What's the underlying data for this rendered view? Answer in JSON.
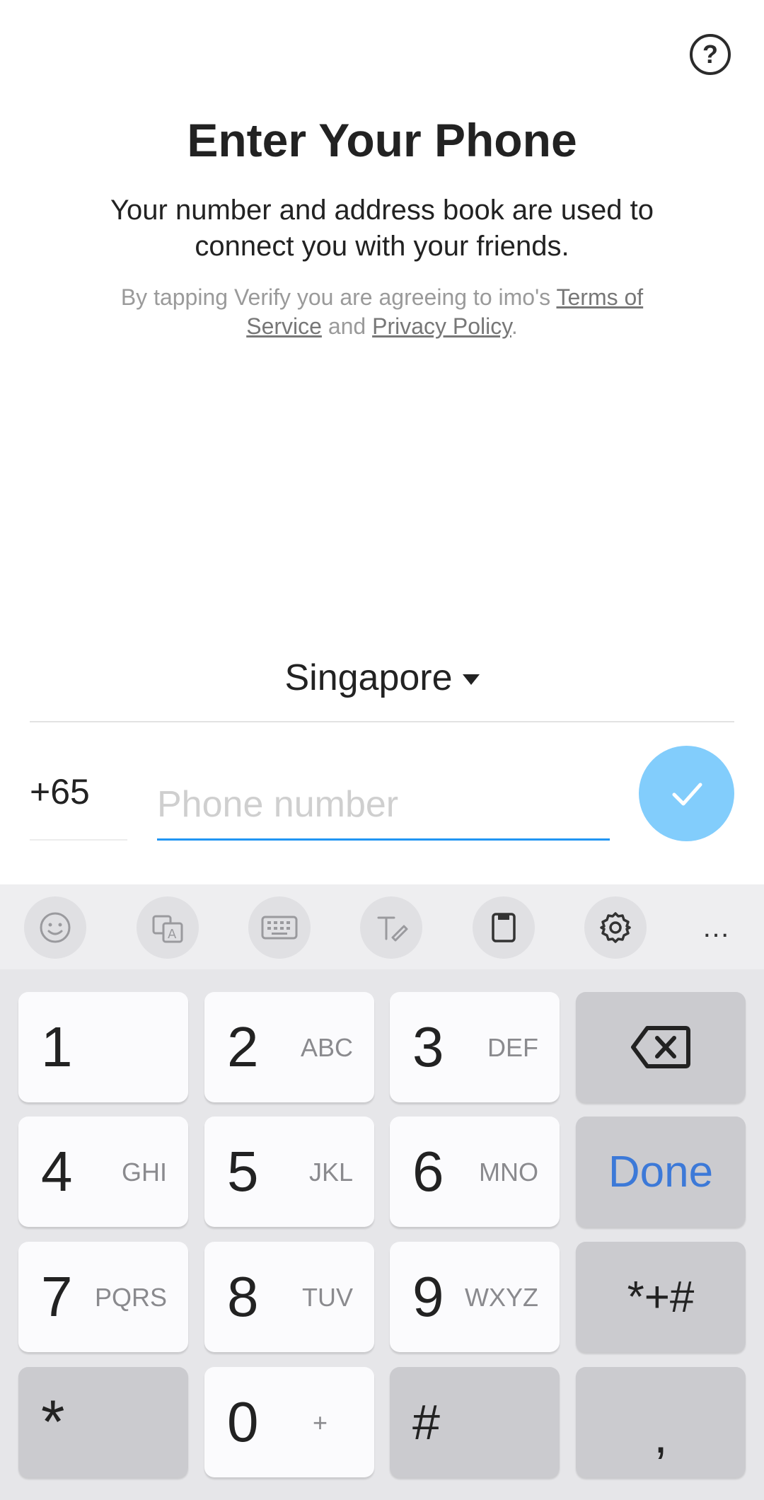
{
  "header": {
    "help_icon": "?",
    "title": "Enter Your Phone",
    "subtitle": "Your number and address book are used to connect you with your friends.",
    "terms_prefix": "By tapping Verify you are agreeing to imo's ",
    "terms_link": "Terms of Service",
    "terms_and": " and ",
    "privacy_link": "Privacy Policy",
    "terms_suffix": "."
  },
  "form": {
    "country": "Singapore",
    "country_code": "+65",
    "phone_placeholder": "Phone number",
    "phone_value": ""
  },
  "colors": {
    "accent": "#2196f3",
    "verify_button": "#82cdfc",
    "done_text": "#3c79d8"
  },
  "keyboard": {
    "toolbar_icons": [
      "emoji-icon",
      "text-translate-icon",
      "keyboard-icon",
      "handwriting-icon",
      "clipboard-icon",
      "gear-icon",
      "more-icon"
    ],
    "toolbar_more": "…",
    "keys": {
      "k1": {
        "digit": "1",
        "letters": ""
      },
      "k2": {
        "digit": "2",
        "letters": "ABC"
      },
      "k3": {
        "digit": "3",
        "letters": "DEF"
      },
      "k4": {
        "digit": "4",
        "letters": "GHI"
      },
      "k5": {
        "digit": "5",
        "letters": "JKL"
      },
      "k6": {
        "digit": "6",
        "letters": "MNO"
      },
      "k7": {
        "digit": "7",
        "letters": "PQRS"
      },
      "k8": {
        "digit": "8",
        "letters": "TUV"
      },
      "k9": {
        "digit": "9",
        "letters": "WXYZ"
      },
      "k0": {
        "digit": "0",
        "letters": "+"
      }
    },
    "done": "Done",
    "symbols": "*+#",
    "star": "*",
    "hash": "#",
    "comma": ","
  }
}
